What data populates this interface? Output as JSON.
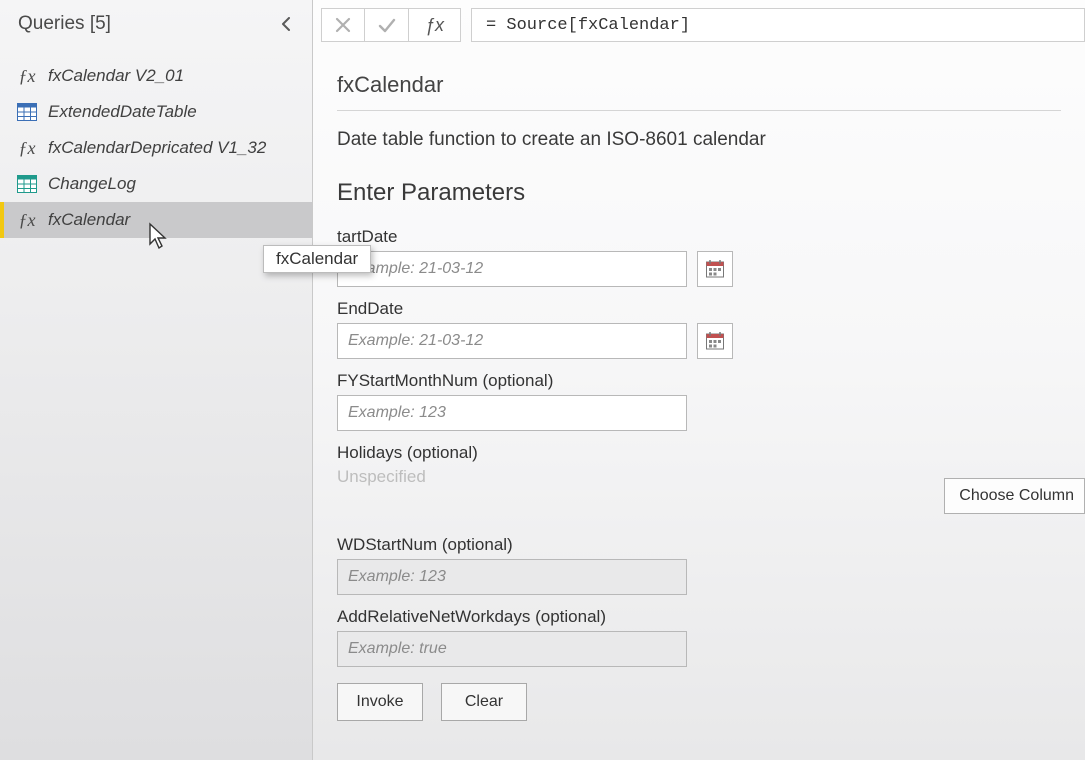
{
  "sidebar": {
    "title": "Queries",
    "count": "[5]",
    "items": [
      {
        "icon": "fx",
        "label": "fxCalendar V2_01"
      },
      {
        "icon": "table-blue",
        "label": "ExtendedDateTable"
      },
      {
        "icon": "fx",
        "label": "fxCalendarDepricated V1_32"
      },
      {
        "icon": "table-teal",
        "label": "ChangeLog"
      },
      {
        "icon": "fx",
        "label": "fxCalendar",
        "selected": true
      }
    ],
    "tooltip": "fxCalendar"
  },
  "formula_bar": {
    "expression": "= Source[fxCalendar]"
  },
  "function": {
    "name": "fxCalendar",
    "description": "Date table function to create an ISO-8601 calendar",
    "params_title": "Enter Parameters",
    "parameters": {
      "start_date": {
        "label": "tartDate",
        "placeholder": "Example: 21-03-12"
      },
      "end_date": {
        "label": "EndDate",
        "placeholder": "Example: 21-03-12"
      },
      "fy_start": {
        "label": "FYStartMonthNum (optional)",
        "placeholder": "Example: 123"
      },
      "holidays": {
        "label": "Holidays (optional)",
        "unspecified_text": "Unspecified"
      },
      "wd_start": {
        "label": "WDStartNum (optional)",
        "placeholder": "Example: 123"
      },
      "add_rel_nw": {
        "label": "AddRelativeNetWorkdays (optional)",
        "placeholder": "Example: true"
      }
    },
    "choose_column_label": "Choose Column",
    "invoke_label": "Invoke",
    "clear_label": "Clear"
  }
}
